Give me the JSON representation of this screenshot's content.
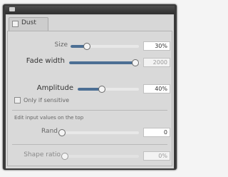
{
  "panel": {
    "tab_label": "Dust"
  },
  "rows": {
    "size": {
      "label": "Size",
      "value_text": "30%",
      "level": 0.24
    },
    "fade": {
      "label": "Fade width",
      "value_text": "2000",
      "level": 0.93
    },
    "amplitude": {
      "label": "Amplitude",
      "value_text": "40%",
      "level": 0.4
    },
    "offset": {
      "label": "Rand",
      "value_text": "0",
      "level": 0.0
    },
    "shape": {
      "label": "Shape ratio",
      "value_text": "0%",
      "level": 0.0
    }
  },
  "checkbox": {
    "label": "Only if sensitive"
  },
  "section": {
    "caption": "Edit input values on the top"
  }
}
